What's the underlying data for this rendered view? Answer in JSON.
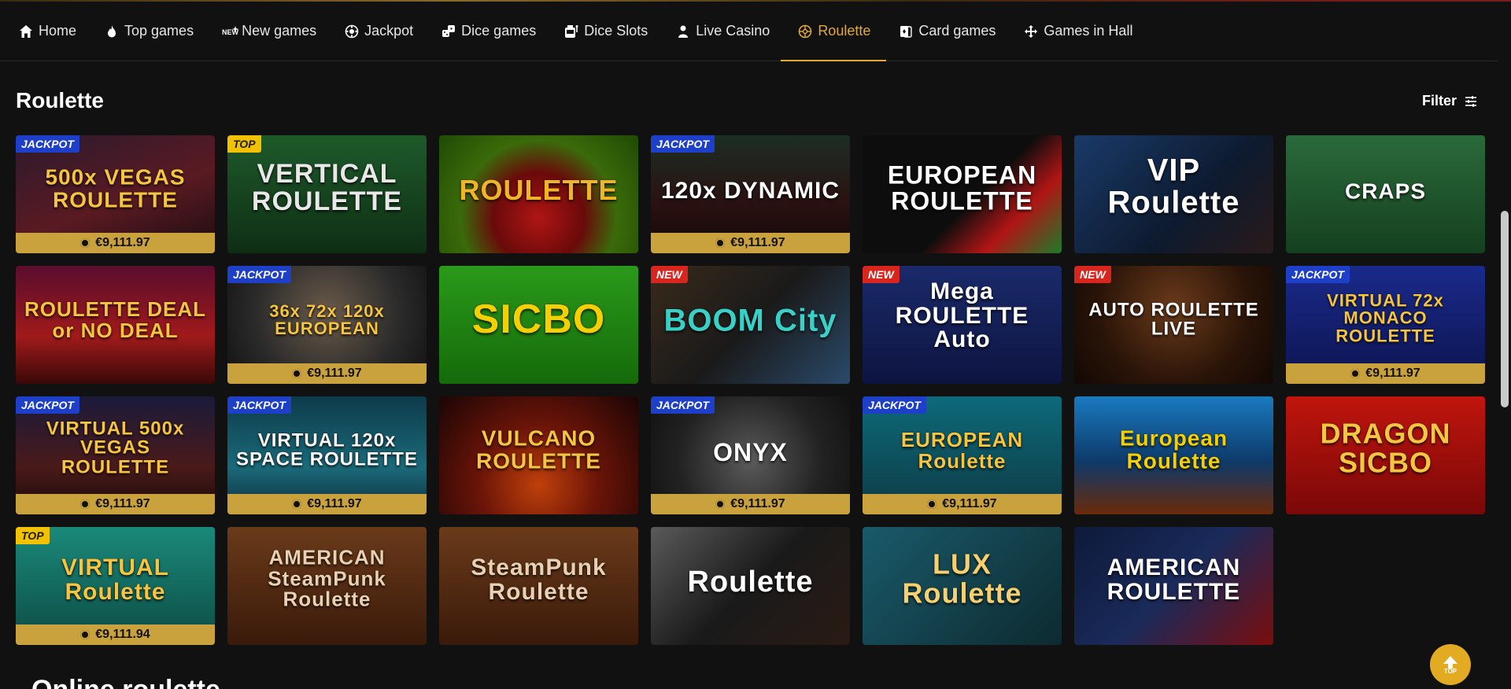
{
  "nav": [
    {
      "label": "Home",
      "icon": "home-icon",
      "active": false
    },
    {
      "label": "Top games",
      "icon": "flame-icon",
      "active": false
    },
    {
      "label": "New games",
      "icon": "new-icon",
      "active": false
    },
    {
      "label": "Jackpot",
      "icon": "jackpot-icon",
      "active": false
    },
    {
      "label": "Dice games",
      "icon": "dice-icon",
      "active": false
    },
    {
      "label": "Dice Slots",
      "icon": "slot-machine-icon",
      "active": false
    },
    {
      "label": "Live Casino",
      "icon": "dealer-icon",
      "active": false
    },
    {
      "label": "Roulette",
      "icon": "roulette-icon",
      "active": true
    },
    {
      "label": "Card games",
      "icon": "cards-icon",
      "active": false
    },
    {
      "label": "Games in Hall",
      "icon": "move-icon",
      "active": false
    }
  ],
  "page": {
    "title": "Roulette",
    "filter_label": "Filter",
    "next_section_title": "Online roulette"
  },
  "colors": {
    "accent": "#e0a93b",
    "prize_bar": "#c9a13d",
    "jackpot_badge": "#1e3fc7",
    "top_badge": "#f2c200",
    "new_badge": "#d8261f"
  },
  "games": [
    {
      "title": "500x VEGAS ROULETTE",
      "badge": "JACKPOT",
      "badge_type": "jackpot",
      "prize": "€9,111.97",
      "bg": "linear-gradient(160deg,#2b1a2e,#5a1a22 55%,#1a0d10)",
      "fg": "#f5c542",
      "size": 28
    },
    {
      "title": "VERTICAL ROULETTE",
      "badge": "TOP",
      "badge_type": "top",
      "prize": "",
      "bg": "linear-gradient(180deg,#1e5a2a,#0e2e14)",
      "fg": "#e8e8e8",
      "size": 34
    },
    {
      "title": "ROULETTE",
      "badge": "",
      "badge_type": "",
      "prize": "",
      "bg": "radial-gradient(circle at 50% 70%,#b01515 0,#6a0a0a 35%,#3a6a0a 60%,#1f4a05)",
      "fg": "#f0b429",
      "size": 36
    },
    {
      "title": "120x DYNAMIC",
      "badge": "JACKPOT",
      "badge_type": "jackpot",
      "prize": "€9,111.97",
      "bg": "linear-gradient(180deg,#1c2e24,#2a1010 60%,#120808)",
      "fg": "#ffffff",
      "size": 30
    },
    {
      "title": "EUROPEAN ROULETTE",
      "badge": "",
      "badge_type": "",
      "prize": "",
      "bg": "linear-gradient(135deg,#0d0d0d 55%,#b01515 75%,#1d7a2a)",
      "fg": "#ffffff",
      "size": 32
    },
    {
      "title": "VIP Roulette",
      "badge": "",
      "badge_type": "",
      "prize": "",
      "bg": "linear-gradient(135deg,#1a3a6a,#0d1a2e 60%,#2a1a1a)",
      "fg": "#ffffff",
      "size": 40
    },
    {
      "title": "CRAPS",
      "badge": "",
      "badge_type": "",
      "prize": "",
      "bg": "linear-gradient(180deg,#2a6a3a,#14401f)",
      "fg": "#ffffff",
      "size": 28
    },
    {
      "title": "ROULETTE DEAL or NO DEAL",
      "badge": "",
      "badge_type": "",
      "prize": "",
      "bg": "linear-gradient(180deg,#5a0d2e,#a01a1a 60%,#3a0808)",
      "fg": "#f5c542",
      "size": 26
    },
    {
      "title": "36x 72x 120x EUROPEAN",
      "badge": "JACKPOT",
      "badge_type": "jackpot",
      "prize": "€9,111.97",
      "bg": "radial-gradient(circle at 50% 40%,#6a5a4a,#2a2a2a 60%,#111)",
      "fg": "#f5c542",
      "size": 22
    },
    {
      "title": "SICBO",
      "badge": "",
      "badge_type": "",
      "prize": "",
      "bg": "linear-gradient(180deg,#2a9a1a,#156a0a)",
      "fg": "#f5d000",
      "size": 52
    },
    {
      "title": "BOOM City",
      "badge": "NEW",
      "badge_type": "new",
      "prize": "",
      "bg": "linear-gradient(135deg,#3a2a1a,#1a1a1a 50%,#2a4a6a)",
      "fg": "#39d0c8",
      "size": 40
    },
    {
      "title": "Mega ROULETTE Auto",
      "badge": "NEW",
      "badge_type": "new",
      "prize": "",
      "bg": "linear-gradient(180deg,#1a2a6a,#0d1440)",
      "fg": "#ffffff",
      "size": 30
    },
    {
      "title": "AUTO ROULETTE LIVE",
      "badge": "NEW",
      "badge_type": "new",
      "prize": "",
      "bg": "radial-gradient(circle at 50% 35%,#6a3a1a,#2a1408 60%,#120804)",
      "fg": "#ffffff",
      "size": 24
    },
    {
      "title": "VIRTUAL 72x MONACO ROULETTE",
      "badge": "JACKPOT",
      "badge_type": "jackpot",
      "prize": "€9,111.97",
      "bg": "linear-gradient(180deg,#1a2a8a,#0d1450)",
      "fg": "#f5c542",
      "size": 22
    },
    {
      "title": "VIRTUAL 500x VEGAS ROULETTE",
      "badge": "JACKPOT",
      "badge_type": "jackpot",
      "prize": "€9,111.97",
      "bg": "linear-gradient(180deg,#1a1a3a,#4a1a1a 60%,#1a0808)",
      "fg": "#f5c542",
      "size": 24
    },
    {
      "title": "VIRTUAL 120x SPACE ROULETTE",
      "badge": "JACKPOT",
      "badge_type": "jackpot",
      "prize": "€9,111.97",
      "bg": "linear-gradient(180deg,#0d3a4a,#1a6a7a 60%,#0d2a3a)",
      "fg": "#ffffff",
      "size": 24
    },
    {
      "title": "VULCANO ROULETTE",
      "badge": "",
      "badge_type": "",
      "prize": "",
      "bg": "radial-gradient(circle at 50% 75%,#c0400a,#6a1408 45%,#1a0505)",
      "fg": "#f5c542",
      "size": 28
    },
    {
      "title": "ONYX",
      "badge": "JACKPOT",
      "badge_type": "jackpot",
      "prize": "€9,111.97",
      "bg": "radial-gradient(circle at 50% 55%,#5a5a5a,#222 60%,#111)",
      "fg": "#ffffff",
      "size": 32
    },
    {
      "title": "EUROPEAN Roulette",
      "badge": "JACKPOT",
      "badge_type": "jackpot",
      "prize": "€9,111.97",
      "bg": "linear-gradient(180deg,#0d6a7a,#0d3a44)",
      "fg": "#f5c542",
      "size": 26
    },
    {
      "title": "European Roulette",
      "badge": "",
      "badge_type": "",
      "prize": "",
      "bg": "linear-gradient(180deg,#1a7ac0,#0d3a6a 55%,#6a2a0a)",
      "fg": "#f5d000",
      "size": 28
    },
    {
      "title": "DRAGON SICBO",
      "badge": "",
      "badge_type": "",
      "prize": "",
      "bg": "linear-gradient(180deg,#c0150d,#7a0808)",
      "fg": "#f5c542",
      "size": 36
    },
    {
      "title": "VIRTUAL Roulette",
      "badge": "TOP",
      "badge_type": "top",
      "prize": "€9,111.94",
      "bg": "linear-gradient(180deg,#1a8a7a,#0d4a44)",
      "fg": "#f5c542",
      "size": 30
    },
    {
      "title": "AMERICAN SteamPunk Roulette",
      "badge": "",
      "badge_type": "",
      "prize": "",
      "bg": "linear-gradient(180deg,#6a3a1a,#3a1a0a)",
      "fg": "#e8d0b0",
      "size": 26
    },
    {
      "title": "SteamPunk Roulette",
      "badge": "",
      "badge_type": "",
      "prize": "",
      "bg": "linear-gradient(180deg,#6a3a1a,#3a1a0a)",
      "fg": "#e8d0b0",
      "size": 30
    },
    {
      "title": "Roulette",
      "badge": "",
      "badge_type": "",
      "prize": "",
      "bg": "linear-gradient(135deg,#5a5a5a,#1a1a1a 50%,#2a1a14)",
      "fg": "#ffffff",
      "size": 38
    },
    {
      "title": "LUX Roulette",
      "badge": "",
      "badge_type": "",
      "prize": "",
      "bg": "linear-gradient(135deg,#1a5a6a,#0d2a30)",
      "fg": "#f5d070",
      "size": 36
    },
    {
      "title": "AMERICAN ROULETTE",
      "badge": "",
      "badge_type": "",
      "prize": "",
      "bg": "linear-gradient(135deg,#0d1a3a,#1a2a5a 50%,#7a0d0d)",
      "fg": "#ffffff",
      "size": 30
    }
  ]
}
